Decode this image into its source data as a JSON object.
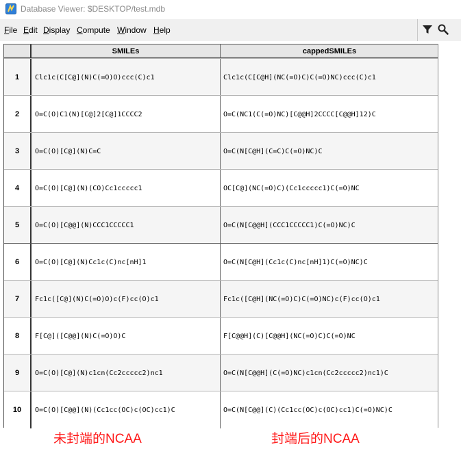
{
  "window": {
    "title": "Database Viewer: $DESKTOP/test.mdb"
  },
  "menu": {
    "items": [
      "File",
      "Edit",
      "Display",
      "Compute",
      "Window",
      "Help"
    ]
  },
  "toolbar": {
    "icons": [
      "filter-icon",
      "search-icon"
    ]
  },
  "table": {
    "columns": [
      "SMILEs",
      "cappedSMILEs"
    ],
    "rows": [
      {
        "num": "1",
        "smiles": "Clc1c(C[C@](N)C(=O)O)ccc(C)c1",
        "capped": "Clc1c(C[C@H](NC(=O)C)C(=O)NC)ccc(C)c1"
      },
      {
        "num": "2",
        "smiles": "O=C(O)C1(N)[C@]2[C@]1CCCC2",
        "capped": "O=C(NC1(C(=O)NC)[C@@H]2CCCC[C@@H]12)C"
      },
      {
        "num": "3",
        "smiles": "O=C(O)[C@](N)C=C",
        "capped": "O=C(N[C@H](C=C)C(=O)NC)C"
      },
      {
        "num": "4",
        "smiles": "O=C(O)[C@](N)(CO)Cc1ccccc1",
        "capped": "OC[C@](NC(=O)C)(Cc1ccccc1)C(=O)NC"
      },
      {
        "num": "5",
        "smiles": "O=C(O)[C@@](N)CCC1CCCCC1",
        "capped": "O=C(N[C@@H](CCC1CCCCC1)C(=O)NC)C"
      },
      {
        "num": "6",
        "smiles": "O=C(O)[C@](N)Cc1c(C)nc[nH]1",
        "capped": "O=C(N[C@H](Cc1c(C)nc[nH]1)C(=O)NC)C"
      },
      {
        "num": "7",
        "smiles": "Fc1c([C@](N)C(=O)O)c(F)cc(O)c1",
        "capped": "Fc1c([C@H](NC(=O)C)C(=O)NC)c(F)cc(O)c1"
      },
      {
        "num": "8",
        "smiles": "F[C@]([C@@](N)C(=O)O)C",
        "capped": "F[C@@H](C)[C@@H](NC(=O)C)C(=O)NC"
      },
      {
        "num": "9",
        "smiles": "O=C(O)[C@](N)c1cn(Cc2ccccc2)nc1",
        "capped": "O=C(N[C@@H](C(=O)NC)c1cn(Cc2ccccc2)nc1)C"
      },
      {
        "num": "10",
        "smiles": "O=C(O)[C@@](N)(Cc1cc(OC)c(OC)cc1)C",
        "capped": "O=C(N[C@@](C)(Cc1cc(OC)c(OC)cc1)C(=O)NC)C"
      }
    ]
  },
  "annotations": {
    "left": "未封端的NCAA",
    "right": "封端后的NCAA",
    "color": "#ff1a1a"
  }
}
